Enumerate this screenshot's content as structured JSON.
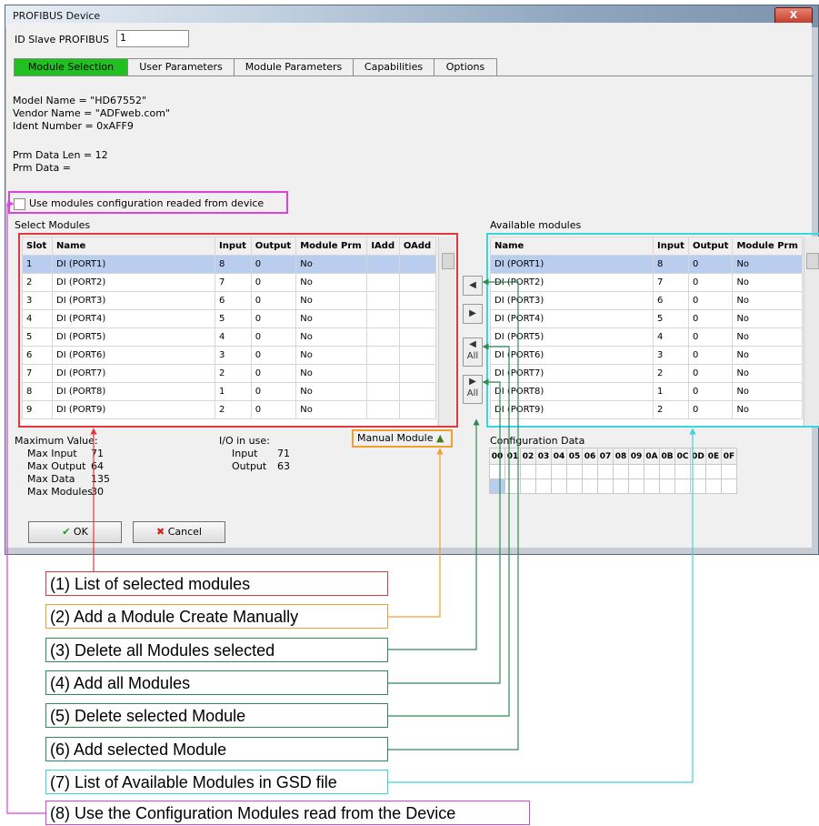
{
  "window": {
    "title": "PROFIBUS Device",
    "close": "X"
  },
  "id_slave": {
    "label": "ID Slave PROFIBUS",
    "value": "1"
  },
  "tabs": [
    "Module Selection",
    "User Parameters",
    "Module Parameters",
    "Capabilities",
    "Options"
  ],
  "info": {
    "model": "Model Name = \"HD67552\"",
    "vendor": "Vendor Name = \"ADFweb.com\"",
    "ident": "Ident Number = 0xAFF9",
    "prm_len": "Prm Data Len = 12",
    "prm_data": "Prm Data ="
  },
  "use_modules_checkbox": "Use modules configuration readed from device",
  "select_modules": {
    "title": "Select Modules",
    "columns": [
      "Slot",
      "Name",
      "Input",
      "Output",
      "Module Prm",
      "IAdd",
      "OAdd"
    ],
    "rows": [
      [
        "1",
        "DI (PORT1)",
        "8",
        "0",
        "No",
        "",
        ""
      ],
      [
        "2",
        "DI (PORT2)",
        "7",
        "0",
        "No",
        "",
        ""
      ],
      [
        "3",
        "DI (PORT3)",
        "6",
        "0",
        "No",
        "",
        ""
      ],
      [
        "4",
        "DI (PORT4)",
        "5",
        "0",
        "No",
        "",
        ""
      ],
      [
        "5",
        "DI (PORT5)",
        "4",
        "0",
        "No",
        "",
        ""
      ],
      [
        "6",
        "DI (PORT6)",
        "3",
        "0",
        "No",
        "",
        ""
      ],
      [
        "7",
        "DI (PORT7)",
        "2",
        "0",
        "No",
        "",
        ""
      ],
      [
        "8",
        "DI (PORT8)",
        "1",
        "0",
        "No",
        "",
        ""
      ],
      [
        "9",
        "DI (PORT9)",
        "2",
        "0",
        "No",
        "",
        ""
      ]
    ]
  },
  "available_modules": {
    "title": "Available modules",
    "columns": [
      "Name",
      "Input",
      "Output",
      "Module Prm"
    ],
    "rows": [
      [
        "DI (PORT1)",
        "8",
        "0",
        "No"
      ],
      [
        "DI (PORT2)",
        "7",
        "0",
        "No"
      ],
      [
        "DI (PORT3)",
        "6",
        "0",
        "No"
      ],
      [
        "DI (PORT4)",
        "5",
        "0",
        "No"
      ],
      [
        "DI (PORT5)",
        "4",
        "0",
        "No"
      ],
      [
        "DI (PORT6)",
        "3",
        "0",
        "No"
      ],
      [
        "DI (PORT7)",
        "2",
        "0",
        "No"
      ],
      [
        "DI (PORT8)",
        "1",
        "0",
        "No"
      ],
      [
        "DI (PORT9)",
        "2",
        "0",
        "No"
      ]
    ]
  },
  "move_buttons": {
    "all": "All"
  },
  "max_values": {
    "title": "Maximum Value:",
    "rows": [
      [
        "Max Input",
        "71"
      ],
      [
        "Max Output",
        "64"
      ],
      [
        "Max Data",
        "135"
      ],
      [
        "Max Modules",
        "30"
      ]
    ]
  },
  "io_in_use": {
    "title": "I/O in use:",
    "rows": [
      [
        "Input",
        "71"
      ],
      [
        "Output",
        "63"
      ]
    ]
  },
  "manual_module": "Manual Module",
  "config_data": {
    "title": "Configuration Data",
    "headers": [
      "00",
      "01",
      "02",
      "03",
      "04",
      "05",
      "06",
      "07",
      "08",
      "09",
      "0A",
      "0B",
      "0C",
      "0D",
      "0E",
      "0F"
    ]
  },
  "buttons": {
    "ok": "OK",
    "cancel": "Cancel"
  },
  "callouts": [
    {
      "text": "(1) List of selected modules",
      "color": "#e2373f"
    },
    {
      "text": "(2) Add a Module Create Manually",
      "color": "#f0a030"
    },
    {
      "text": "(3) Delete all Modules selected",
      "color": "#2e8b57"
    },
    {
      "text": "(4) Add all Modules",
      "color": "#2e8b57"
    },
    {
      "text": "(5) Delete selected Module",
      "color": "#2e8b57"
    },
    {
      "text": "(6) Add selected Module",
      "color": "#2e8b57"
    },
    {
      "text": "(7) List of Available Modules in GSD file",
      "color": "#3ad6e0"
    },
    {
      "text": "(8) Use the Configuration Modules read from the Device",
      "color": "#e040e0"
    }
  ]
}
